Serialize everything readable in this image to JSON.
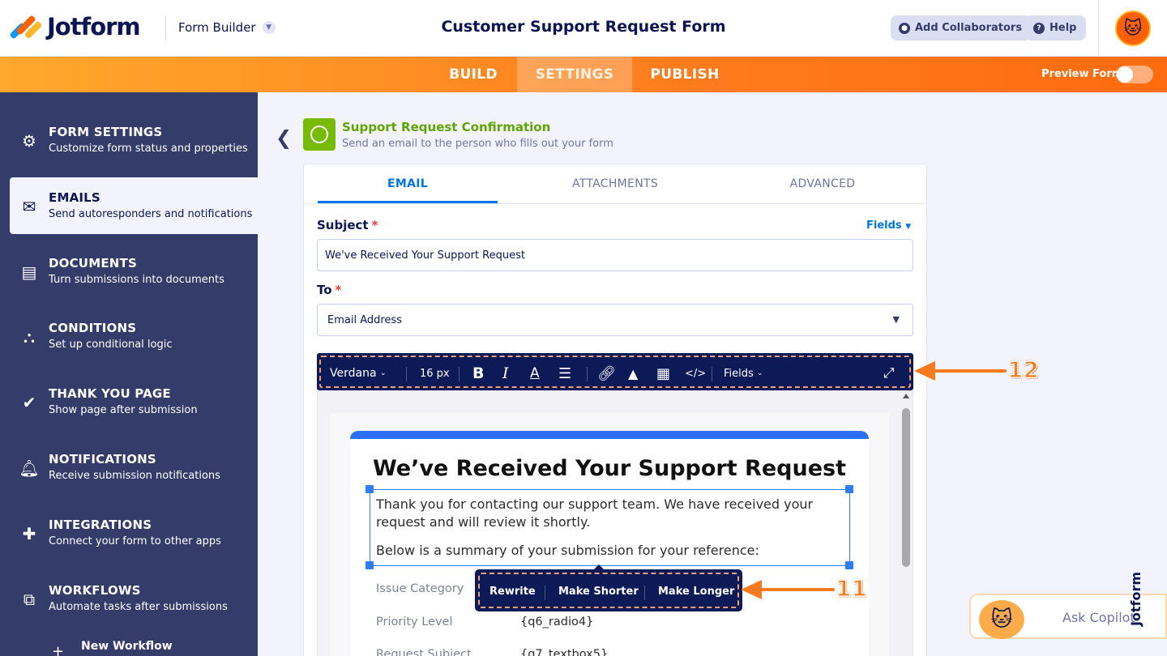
{
  "header": {
    "brand": "Jotform",
    "builder_label": "Form Builder",
    "form_title": "Customer Support Request Form",
    "add_collaborators": "Add Collaborators",
    "help": "Help"
  },
  "nav": {
    "tabs": [
      "BUILD",
      "SETTINGS",
      "PUBLISH"
    ],
    "active_tab": "SETTINGS",
    "preview_label": "Preview Form",
    "preview_enabled": false
  },
  "sidebar": {
    "items": [
      {
        "title": "FORM SETTINGS",
        "subtitle": "Customize form status and properties",
        "icon": "gear-icon"
      },
      {
        "title": "EMAILS",
        "subtitle": "Send autoresponders and notifications",
        "icon": "envelope-icon"
      },
      {
        "title": "DOCUMENTS",
        "subtitle": "Turn submissions into documents",
        "icon": "document-icon"
      },
      {
        "title": "CONDITIONS",
        "subtitle": "Set up conditional logic",
        "icon": "conditions-icon"
      },
      {
        "title": "THANK YOU PAGE",
        "subtitle": "Show page after submission",
        "icon": "check-circle-icon"
      },
      {
        "title": "NOTIFICATIONS",
        "subtitle": "Receive submission notifications",
        "icon": "bell-icon"
      },
      {
        "title": "INTEGRATIONS",
        "subtitle": "Connect your form to other apps",
        "icon": "puzzle-icon"
      },
      {
        "title": "WORKFLOWS",
        "subtitle": "Automate tasks after submissions",
        "icon": "workflow-icon"
      }
    ],
    "active_item": "EMAILS",
    "new_workflow": "New Workflow"
  },
  "email_panel": {
    "title": "Support Request Confirmation",
    "subtitle": "Send an email to the person who fills out your form",
    "tabs": [
      "EMAIL",
      "ATTACHMENTS",
      "ADVANCED"
    ],
    "active_tab": "EMAIL",
    "subject_label": "Subject",
    "subject_value": "We've Received Your Support Request",
    "fields_link": "Fields",
    "to_label": "To",
    "to_value": "Email Address"
  },
  "toolbar": {
    "font": "Verdana",
    "size": "16 px",
    "fields": "Fields"
  },
  "email_body": {
    "heading": "We’ve Received Your Support Request",
    "line1": "Thank you for contacting our support team. We have received your",
    "line2": "request and will review it shortly.",
    "line3": "Below is a summary of your submission for your reference:",
    "rows": [
      {
        "label": "Issue Category",
        "value": ""
      },
      {
        "label": "Priority Level",
        "value": "{q6_radio4}"
      },
      {
        "label": "Request Subject",
        "value": "{q7_textbox5}"
      }
    ]
  },
  "ai_actions": {
    "rewrite": "Rewrite",
    "shorter": "Make Shorter",
    "longer": "Make Longer"
  },
  "callouts": {
    "toolbar": "12",
    "ai_popup": "11"
  },
  "copilot": {
    "label": "Ask Copilot"
  },
  "watermark": "Jotform",
  "colors": {
    "brand_navy": "#0a1551",
    "orange": "#ff7b1c",
    "sidebar": "#343c6a",
    "link_blue": "#0075e3",
    "success_green": "#78bb07"
  }
}
